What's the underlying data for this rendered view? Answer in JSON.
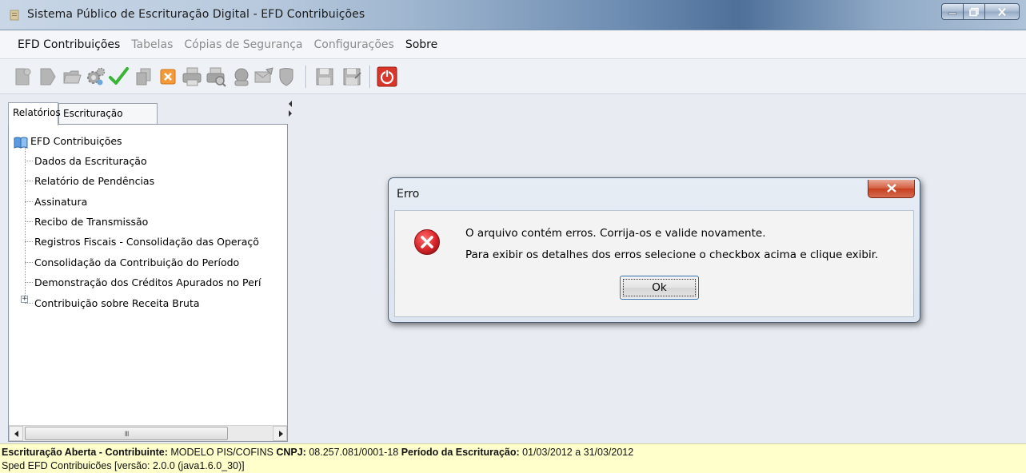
{
  "window": {
    "title": "Sistema Público de Escrituração Digital - EFD Contribuições"
  },
  "menu": {
    "items": [
      {
        "label": "EFD Contribuições",
        "enabled": true
      },
      {
        "label": "Tabelas",
        "enabled": false
      },
      {
        "label": "Cópias de Segurança",
        "enabled": false
      },
      {
        "label": "Configurações",
        "enabled": false
      },
      {
        "label": "Sobre",
        "enabled": true
      }
    ]
  },
  "toolbar": {
    "icons": [
      "new-document-icon",
      "open-document-icon",
      "folder-icon",
      "gears-icon",
      "checkmark-icon",
      "copy-icon",
      "cancel-icon",
      "print-icon",
      "print-preview-icon",
      "signature-icon",
      "email-icon",
      "shield-icon",
      "save-icon",
      "save-as-icon",
      "exit-icon"
    ]
  },
  "left_panel": {
    "tabs": [
      {
        "label": "Relatórios",
        "active": true
      },
      {
        "label": "Escrituração",
        "active": false
      }
    ],
    "tree": {
      "root": "EFD Contribuições",
      "children": [
        "Dados da Escrituração",
        "Relatório de Pendências",
        "Assinatura",
        "Recibo de Transmissão",
        "Registros Fiscais - Consolidação das Operaçõ",
        "Consolidação da Contribuição do Período",
        "Demonstração dos Créditos Apurados no Perí",
        "Contribuição sobre Receita Bruta"
      ],
      "expander": "+"
    },
    "scrollbar_grip": "III"
  },
  "dialog": {
    "title": "Erro",
    "message_line1": "O arquivo contém erros. Corrija-os e valide novamente.",
    "message_line2": "Para exibir os detalhes dos erros selecione o checkbox acima e clique exibir.",
    "ok_label": "Ok"
  },
  "status": {
    "opened_label": "Escrituração Aberta - Contribuinte:",
    "contribuinte": " MODELO PIS/COFINS ",
    "cnpj_label": "CNPJ:",
    "cnpj": " 08.257.081/0001-18 ",
    "periodo_label": "Período da Escrituração:",
    "periodo": " 01/03/2012 a 31/03/2012",
    "version_line": "Sped EFD Contribuicões [versão: 2.0.0 (java1.6.0_30)]"
  },
  "colors": {
    "status_bg": "#ffffcc",
    "error_red": "#d9262b",
    "exit_red": "#d9362b",
    "check_green": "#3bb437"
  }
}
